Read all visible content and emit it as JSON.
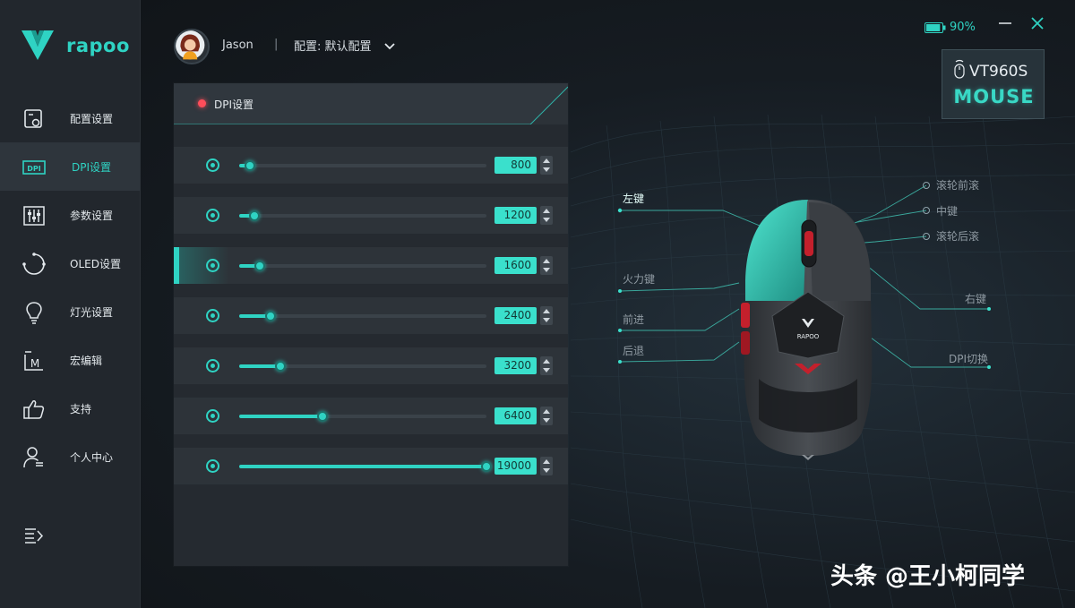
{
  "brand": {
    "name": "rapoo",
    "accent": "#2fd3c3"
  },
  "sidebar": {
    "items": [
      {
        "label": "配置设置",
        "icon": "profile-settings-icon",
        "active": false
      },
      {
        "label": "DPI设置",
        "icon": "dpi-icon",
        "active": true
      },
      {
        "label": "参数设置",
        "icon": "sliders-icon",
        "active": false
      },
      {
        "label": "OLED设置",
        "icon": "oled-icon",
        "active": false
      },
      {
        "label": "灯光设置",
        "icon": "lightbulb-icon",
        "active": false
      },
      {
        "label": "宏编辑",
        "icon": "macro-icon",
        "active": false
      },
      {
        "label": "支持",
        "icon": "thumbs-up-icon",
        "active": false
      },
      {
        "label": "个人中心",
        "icon": "user-center-icon",
        "active": false
      }
    ],
    "collapse_icon": "collapse-menu-icon"
  },
  "header": {
    "user_name": "Jason",
    "separator": "|",
    "profile_label": "配置: ",
    "profile_value": "默认配置"
  },
  "status": {
    "battery_text": "90%",
    "battery_level": 0.9
  },
  "device": {
    "model": "VT960S",
    "type": "MOUSE"
  },
  "dpi_panel": {
    "title": "DPI设置",
    "max_dpi": 19000,
    "rows": [
      {
        "value": "800",
        "dpi": 800,
        "active": false
      },
      {
        "value": "1200",
        "dpi": 1200,
        "active": false
      },
      {
        "value": "1600",
        "dpi": 1600,
        "active": true
      },
      {
        "value": "2400",
        "dpi": 2400,
        "active": false
      },
      {
        "value": "3200",
        "dpi": 3200,
        "active": false
      },
      {
        "value": "6400",
        "dpi": 6400,
        "active": false
      },
      {
        "value": "19000",
        "dpi": 19000,
        "active": false
      }
    ]
  },
  "mouse_callouts": {
    "left_button": "左键",
    "fire_button": "火力键",
    "forward": "前进",
    "back": "后退",
    "wheel_forward": "滚轮前滚",
    "middle_button": "中键",
    "wheel_back": "滚轮后滚",
    "right_button": "右键",
    "dpi_switch": "DPI切换"
  },
  "watermark": "头条 @王小柯同学"
}
